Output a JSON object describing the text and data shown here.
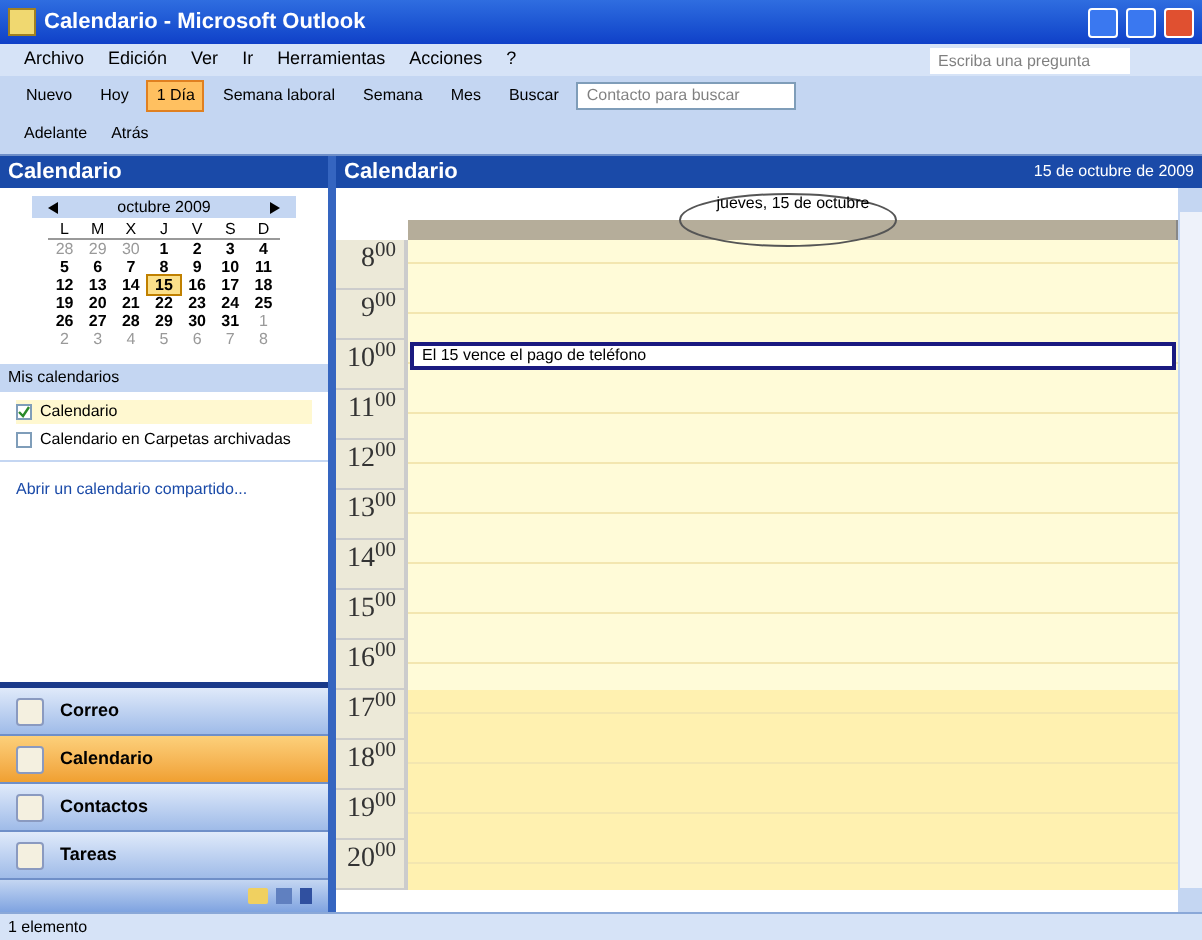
{
  "window": {
    "title": "Calendario - Microsoft Outlook"
  },
  "menu": [
    "Archivo",
    "Edición",
    "Ver",
    "Ir",
    "Herramientas",
    "Acciones",
    "?"
  ],
  "help_field": {
    "placeholder": "Escriba una pregunta"
  },
  "toolbar": [
    {
      "label": "Nuevo",
      "selected": false
    },
    {
      "label": "Hoy",
      "selected": false
    },
    {
      "label": "1 Día",
      "selected": true
    },
    {
      "label": "Semana laboral",
      "selected": false
    },
    {
      "label": "Semana",
      "selected": false
    },
    {
      "label": "Mes",
      "selected": false
    },
    {
      "label": "Buscar",
      "selected": false
    }
  ],
  "contact_search": {
    "placeholder": "Contacto para buscar"
  },
  "web_toolbar": [
    "Adelante",
    "Atrás"
  ],
  "sidebar": {
    "title": "Calendario",
    "mini_calendar": {
      "month": "octubre 2009",
      "weekdays": [
        "L",
        "M",
        "X",
        "J",
        "V",
        "S",
        "D"
      ],
      "weeks": [
        [
          {
            "d": "28",
            "other": true
          },
          {
            "d": "29",
            "other": true
          },
          {
            "d": "30",
            "other": true
          },
          {
            "d": "1",
            "other": false
          },
          {
            "d": "2",
            "other": false
          },
          {
            "d": "3",
            "other": false
          },
          {
            "d": "4",
            "other": false
          }
        ],
        [
          {
            "d": "5",
            "other": false
          },
          {
            "d": "6",
            "other": false
          },
          {
            "d": "7",
            "other": false
          },
          {
            "d": "8",
            "other": false
          },
          {
            "d": "9",
            "other": false
          },
          {
            "d": "10",
            "other": false
          },
          {
            "d": "11",
            "other": false
          }
        ],
        [
          {
            "d": "12",
            "other": false
          },
          {
            "d": "13",
            "other": false
          },
          {
            "d": "14",
            "other": false
          },
          {
            "d": "15",
            "other": false,
            "selected": true
          },
          {
            "d": "16",
            "other": false
          },
          {
            "d": "17",
            "other": false
          },
          {
            "d": "18",
            "other": false
          }
        ],
        [
          {
            "d": "19",
            "other": false
          },
          {
            "d": "20",
            "other": false
          },
          {
            "d": "21",
            "other": false
          },
          {
            "d": "22",
            "other": false
          },
          {
            "d": "23",
            "other": false
          },
          {
            "d": "24",
            "other": false
          },
          {
            "d": "25",
            "other": false
          }
        ],
        [
          {
            "d": "26",
            "other": false
          },
          {
            "d": "27",
            "other": false
          },
          {
            "d": "28",
            "other": false
          },
          {
            "d": "29",
            "other": false
          },
          {
            "d": "30",
            "other": false
          },
          {
            "d": "31",
            "other": false
          },
          {
            "d": "1",
            "other": true
          }
        ],
        [
          {
            "d": "2",
            "other": true
          },
          {
            "d": "3",
            "other": true
          },
          {
            "d": "4",
            "other": true
          },
          {
            "d": "5",
            "other": true
          },
          {
            "d": "6",
            "other": true
          },
          {
            "d": "7",
            "other": true
          },
          {
            "d": "8",
            "other": true
          }
        ]
      ]
    },
    "my_calendars_title": "Mis calendarios",
    "calendars": [
      {
        "label": "Calendario",
        "checked": true
      },
      {
        "label": "Calendario en Carpetas archivadas",
        "checked": false
      }
    ],
    "shared_link": "Abrir un calendario compartido...",
    "nav": [
      {
        "label": "Correo",
        "selected": false
      },
      {
        "label": "Calendario",
        "selected": true
      },
      {
        "label": "Contactos",
        "selected": false
      },
      {
        "label": "Tareas",
        "selected": false
      }
    ]
  },
  "main": {
    "title": "Calendario",
    "date": "15 de octubre de 2009",
    "day_header": "jueves, 15 de octubre",
    "hours": [
      {
        "label": "8$^{00}$",
        "work": true
      },
      {
        "label": "9$^{00}$",
        "work": true
      },
      {
        "label": "10$^{00}$",
        "work": true,
        "event": "El 15 vence el pago de teléfono"
      },
      {
        "label": "11$^{00}$",
        "work": true
      },
      {
        "label": "12$^{00}$",
        "work": true
      },
      {
        "label": "13$^{00}$",
        "work": true
      },
      {
        "label": "14$^{00}$",
        "work": true
      },
      {
        "label": "15$^{00}$",
        "work": true
      },
      {
        "label": "16$^{00}$",
        "work": true
      },
      {
        "label": "17$^{00}$",
        "work": false
      },
      {
        "label": "18$^{00}$",
        "work": false
      },
      {
        "label": "19$^{00}$",
        "work": false
      },
      {
        "label": "20$^{00}$",
        "work": false
      }
    ]
  },
  "status_bar": "1 elemento"
}
